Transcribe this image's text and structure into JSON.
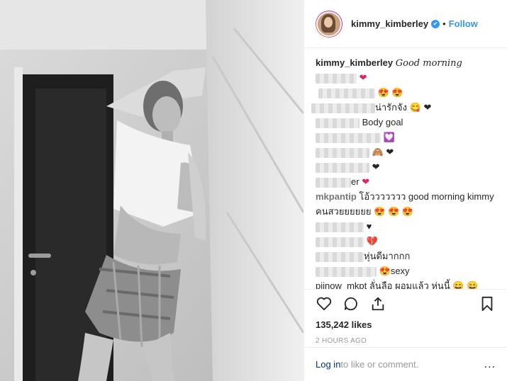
{
  "post": {
    "username": "kimmy_kimberley",
    "verified_badge": "✔",
    "separator": "•",
    "follow_label": "Follow",
    "caption": "Good morning"
  },
  "comments": [
    {
      "text_visible": "",
      "suffix": "❤"
    },
    {
      "text_visible": "",
      "suffix": "😍 😍"
    },
    {
      "text_visible": "น่ารักจัง",
      "suffix": "😋 ❤"
    },
    {
      "text_visible": "Body goal",
      "suffix": ""
    },
    {
      "text_visible": "",
      "suffix": "💟"
    },
    {
      "text_visible": "",
      "suffix": "🙈 ❤"
    },
    {
      "text_visible": "",
      "suffix": "❤"
    },
    {
      "text_visible": "er",
      "suffix": "❤"
    },
    {
      "user": "mkpantip",
      "text_visible": "โอ้ววววววว good morning kimmy",
      "suffix": ""
    },
    {
      "text_visible": "คนสวยยยยยย",
      "suffix": "😍 😍 😍"
    },
    {
      "text_visible": "",
      "suffix": "♥"
    },
    {
      "text_visible": "",
      "suffix": "💔"
    },
    {
      "text_visible": "หุ่นดีมากกก",
      "suffix": ""
    },
    {
      "text_visible": "sexy",
      "suffix": "😍"
    },
    {
      "text_visible": "piinow_mkpt ลั่นลือ ผอมแล้ว หุ่นนี้",
      "suffix": "😄 😄"
    }
  ],
  "actions": {
    "likes": "135,242 likes",
    "time": "2 HOURS AGO"
  },
  "footer": {
    "login": "Log in",
    "rest": " to like or comment.",
    "more": "..."
  }
}
